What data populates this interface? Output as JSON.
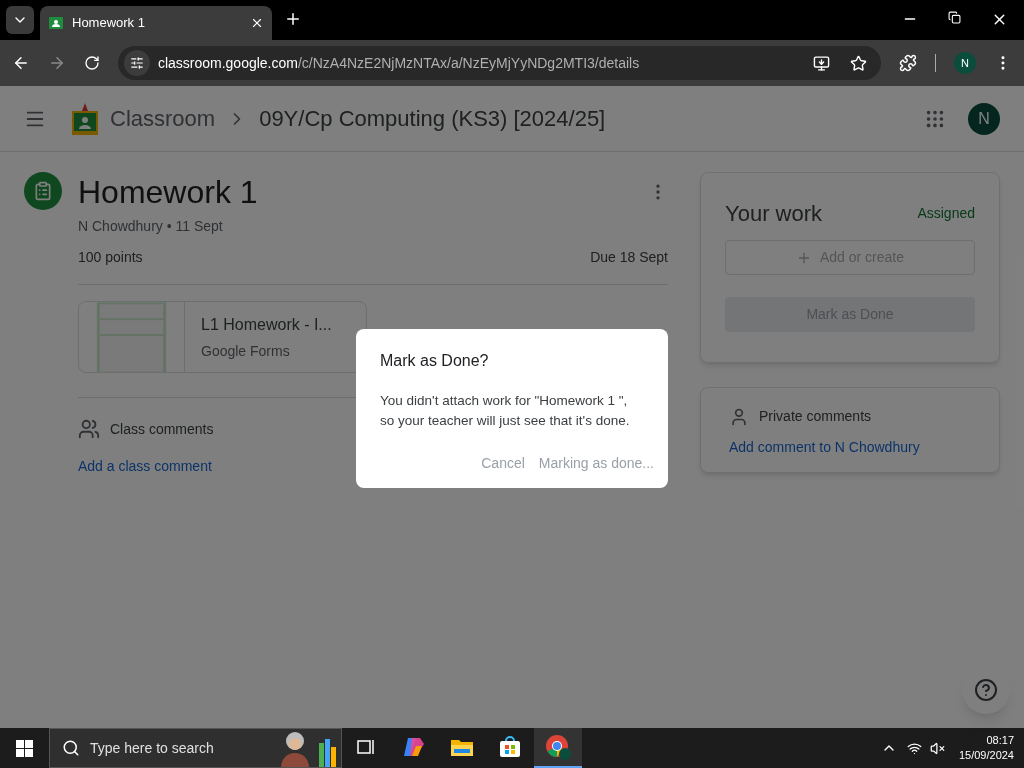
{
  "browser": {
    "tab_title": "Homework 1",
    "url_host": "classroom.google.com",
    "url_path": "/c/NzA4NzE2NjMzNTAx/a/NzEyMjYyNDg2MTI3/details",
    "profile_initial": "N"
  },
  "app_bar": {
    "brand": "Classroom",
    "breadcrumb": "09Y/Cp Computing (KS3) [2024/25]",
    "avatar": "N"
  },
  "assignment": {
    "title": "Homework 1",
    "meta": "N Chowdhury • 11 Sept",
    "points": "100 points",
    "due": "Due 18 Sept",
    "attachment": {
      "title": "L1 Homework - I...",
      "subtitle": "Google Forms"
    },
    "class_comments": {
      "label": "Class comments",
      "link": "Add a class comment"
    }
  },
  "your_work": {
    "title": "Your work",
    "status": "Assigned",
    "add_button": "Add or create",
    "mark_button": {
      "label": "Mark as Done",
      "disabled": true
    }
  },
  "private_comments": {
    "label": "Private comments",
    "link": "Add comment to N Chowdhury"
  },
  "dialog": {
    "title": "Mark as Done?",
    "body": "You didn't attach work for \"Homework 1 \", so your teacher will just see that it's done.",
    "buttons": [
      {
        "label": "Cancel",
        "disabled": true
      },
      {
        "label": "Marking as done...",
        "disabled": true
      }
    ]
  },
  "taskbar": {
    "search_placeholder": "Type here to search",
    "time": "08:17",
    "date": "15/09/2024",
    "apps": [
      {
        "kind": "taskview",
        "selected": false
      },
      {
        "kind": "copilot",
        "selected": false
      },
      {
        "kind": "files",
        "selected": false
      },
      {
        "kind": "store",
        "selected": false
      },
      {
        "kind": "chrome",
        "selected": true
      }
    ]
  }
}
